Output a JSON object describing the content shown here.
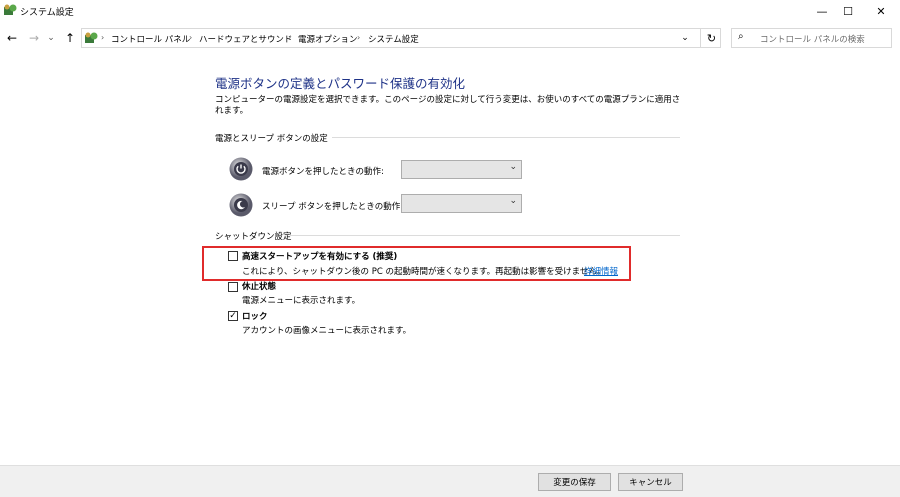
{
  "window": {
    "title": "システム設定",
    "minimize": "—",
    "maximize": "☐",
    "close": "✕"
  },
  "nav": {
    "back": "←",
    "forward": "→",
    "recent": "⌄",
    "up": "↑"
  },
  "address": {
    "breadcrumbs": [
      "コントロール パネル",
      "ハードウェアとサウンド",
      "電源オプション",
      "システム設定"
    ],
    "separator": "›",
    "dropdown": "⌄",
    "refresh": "↻"
  },
  "search": {
    "placeholder": "コントロール パネルの検索",
    "icon": "⌕"
  },
  "main": {
    "title": "電源ボタンの定義とパスワード保護の有効化",
    "description": "コンピューターの電源設定を選択できます。このページの設定に対して行う変更は、お使いのすべての電源プランに適用されます。",
    "power_section": {
      "heading": "電源とスリープ ボタンの設定",
      "rows": [
        {
          "label": "電源ボタンを押したときの動作:",
          "value": ""
        },
        {
          "label": "スリープ ボタンを押したときの動作:",
          "value": ""
        }
      ]
    },
    "shutdown_section": {
      "heading": "シャットダウン設定",
      "options": [
        {
          "title": "高速スタートアップを有効にする (推奨)",
          "desc": "これにより、シャットダウン後の PC の起動時間が速くなります。再起動は影響を受けません。",
          "link": "詳細情報",
          "checked": false
        },
        {
          "title": "休止状態",
          "desc": "電源メニューに表示されます。",
          "checked": false
        },
        {
          "title": "ロック",
          "desc": "アカウントの画像メニューに表示されます。",
          "checked": true
        }
      ]
    }
  },
  "footer": {
    "save": "変更の保存",
    "cancel": "キャンセル"
  },
  "colors": {
    "title_blue": "#1e3287",
    "link_blue": "#0066cc",
    "highlight_red": "#e02b2b"
  },
  "checkmark": "✓"
}
